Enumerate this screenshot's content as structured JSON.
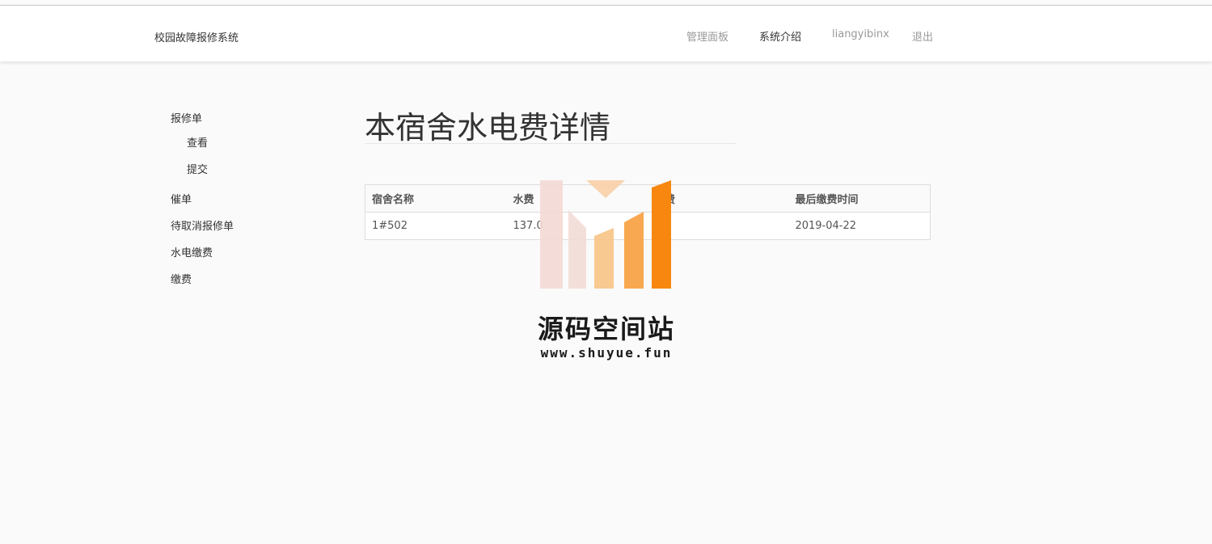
{
  "header": {
    "brand": "校园故障报修系统",
    "nav": [
      {
        "label": "管理面板"
      },
      {
        "label": "系统介绍"
      },
      {
        "label": "liangyibinx"
      },
      {
        "label": "退出"
      }
    ]
  },
  "sidebar": {
    "groups": [
      {
        "label": "报修单",
        "children": [
          {
            "label": "查看"
          },
          {
            "label": "提交"
          }
        ]
      },
      {
        "label": "催单"
      },
      {
        "label": "待取消报修单"
      },
      {
        "label": "水电缴费"
      },
      {
        "label": "缴费"
      }
    ]
  },
  "main": {
    "title": "本宿舍水电费详情",
    "table": {
      "headers": [
        "宿舍名称",
        "水费",
        "电费",
        "最后缴费时间"
      ],
      "rows": [
        [
          "1#502",
          "137.0",
          "0",
          "2019-04-22"
        ]
      ]
    }
  },
  "watermark": {
    "text": "源码空间站",
    "url": "www.shuyue.fun"
  },
  "colors": {
    "accent_orange": "#f7870f",
    "nav_muted": "#999999",
    "border": "#dddddd"
  }
}
